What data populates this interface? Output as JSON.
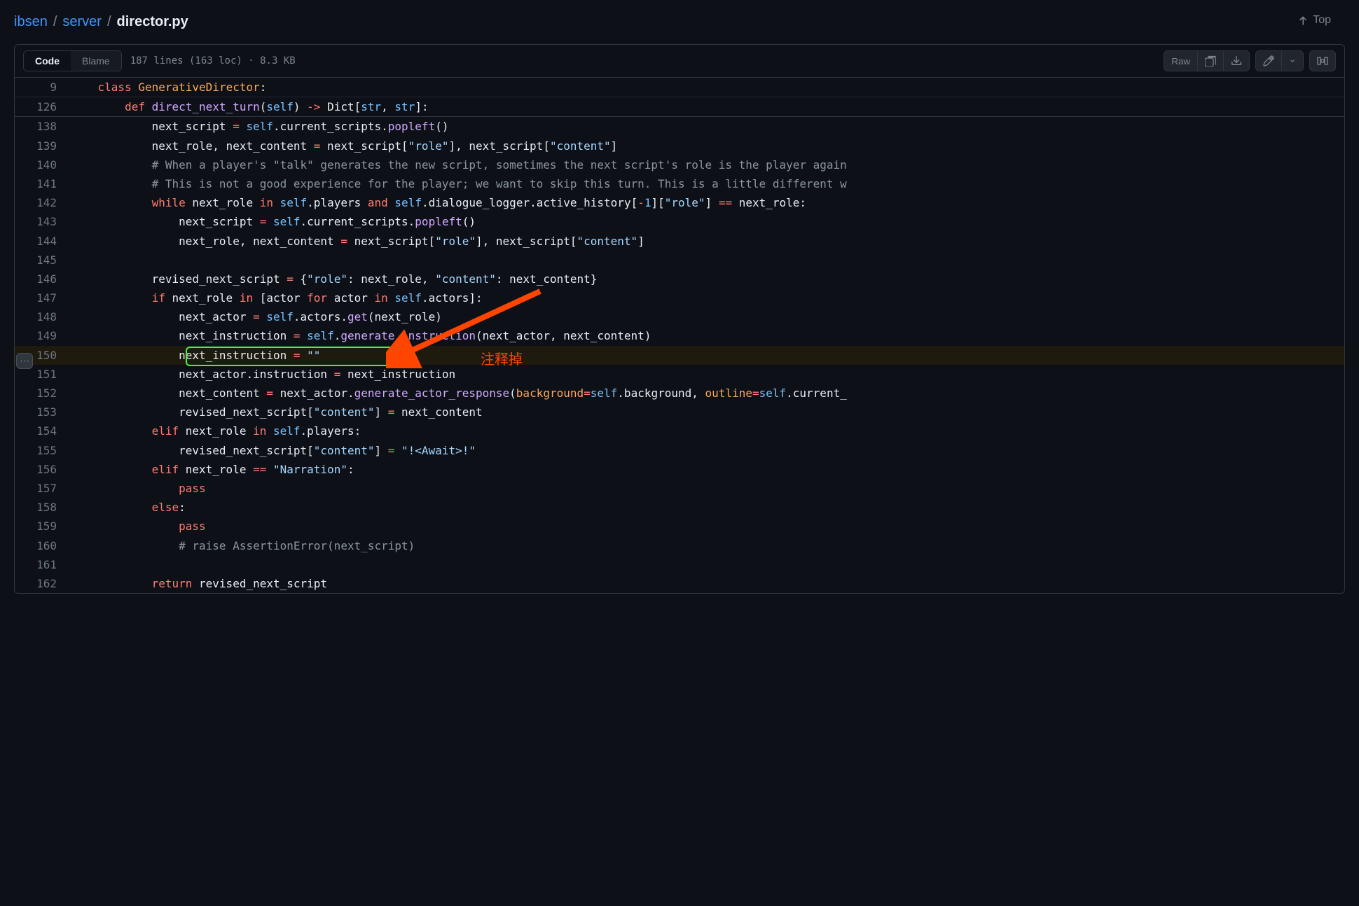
{
  "breadcrumb": {
    "parts": [
      "ibsen",
      "server"
    ],
    "current": "director.py"
  },
  "top_link": "Top",
  "toolbar": {
    "code_tab": "Code",
    "blame_tab": "Blame",
    "file_info": "187 lines (163 loc) · 8.3 KB",
    "raw": "Raw"
  },
  "annotation": "注释掉",
  "sticky": [
    {
      "num": "9",
      "tokens": [
        [
          "    ",
          ""
        ],
        [
          "class",
          "kw"
        ],
        [
          " ",
          ""
        ],
        [
          "GenerativeDirector",
          "cls"
        ],
        [
          ":",
          ""
        ]
      ]
    },
    {
      "num": "126",
      "tokens": [
        [
          "        ",
          ""
        ],
        [
          "def",
          "kw"
        ],
        [
          " ",
          ""
        ],
        [
          "direct_next_turn",
          "fn"
        ],
        [
          "(",
          ""
        ],
        [
          "self",
          "const"
        ],
        [
          ") ",
          ""
        ],
        [
          "->",
          "op"
        ],
        [
          " Dict[",
          ""
        ],
        [
          "str",
          "const"
        ],
        [
          ", ",
          ""
        ],
        [
          "str",
          "const"
        ],
        [
          "]:",
          ""
        ]
      ]
    }
  ],
  "lines": [
    {
      "num": "138",
      "tokens": [
        [
          "            next_script ",
          ""
        ],
        [
          "=",
          "op"
        ],
        [
          " ",
          ""
        ],
        [
          "self",
          "const"
        ],
        [
          ".current_scripts.",
          ""
        ],
        [
          "popleft",
          "fn"
        ],
        [
          "()",
          ""
        ]
      ]
    },
    {
      "num": "139",
      "tokens": [
        [
          "            next_role, next_content ",
          ""
        ],
        [
          "=",
          "op"
        ],
        [
          " next_script[",
          ""
        ],
        [
          "\"role\"",
          "str"
        ],
        [
          "], next_script[",
          ""
        ],
        [
          "\"content\"",
          "str"
        ],
        [
          "]",
          ""
        ]
      ]
    },
    {
      "num": "140",
      "tokens": [
        [
          "            ",
          ""
        ],
        [
          "# When a player's \"talk\" generates the new script, sometimes the next script's role is the player again",
          "cmt"
        ]
      ]
    },
    {
      "num": "141",
      "tokens": [
        [
          "            ",
          ""
        ],
        [
          "# This is not a good experience for the player; we want to skip this turn. This is a little different w",
          "cmt"
        ]
      ]
    },
    {
      "num": "142",
      "tokens": [
        [
          "            ",
          ""
        ],
        [
          "while",
          "kw"
        ],
        [
          " next_role ",
          ""
        ],
        [
          "in",
          "kw"
        ],
        [
          " ",
          ""
        ],
        [
          "self",
          "const"
        ],
        [
          ".players ",
          ""
        ],
        [
          "and",
          "kw"
        ],
        [
          " ",
          ""
        ],
        [
          "self",
          "const"
        ],
        [
          ".dialogue_logger.active_history[",
          ""
        ],
        [
          "-",
          "op"
        ],
        [
          "1",
          "num"
        ],
        [
          "][",
          ""
        ],
        [
          "\"role\"",
          "str"
        ],
        [
          "] ",
          ""
        ],
        [
          "==",
          "op"
        ],
        [
          " next_role:",
          ""
        ]
      ]
    },
    {
      "num": "143",
      "tokens": [
        [
          "                next_script ",
          ""
        ],
        [
          "=",
          "op"
        ],
        [
          " ",
          ""
        ],
        [
          "self",
          "const"
        ],
        [
          ".current_scripts.",
          ""
        ],
        [
          "popleft",
          "fn"
        ],
        [
          "()",
          ""
        ]
      ]
    },
    {
      "num": "144",
      "tokens": [
        [
          "                next_role, next_content ",
          ""
        ],
        [
          "=",
          "op"
        ],
        [
          " next_script[",
          ""
        ],
        [
          "\"role\"",
          "str"
        ],
        [
          "], next_script[",
          ""
        ],
        [
          "\"content\"",
          "str"
        ],
        [
          "]",
          ""
        ]
      ]
    },
    {
      "num": "145",
      "tokens": [
        [
          "",
          ""
        ]
      ]
    },
    {
      "num": "146",
      "tokens": [
        [
          "            revised_next_script ",
          ""
        ],
        [
          "=",
          "op"
        ],
        [
          " {",
          ""
        ],
        [
          "\"role\"",
          "str"
        ],
        [
          ": next_role, ",
          ""
        ],
        [
          "\"content\"",
          "str"
        ],
        [
          ": next_content}",
          ""
        ]
      ]
    },
    {
      "num": "147",
      "tokens": [
        [
          "            ",
          ""
        ],
        [
          "if",
          "kw"
        ],
        [
          " next_role ",
          ""
        ],
        [
          "in",
          "kw"
        ],
        [
          " [actor ",
          ""
        ],
        [
          "for",
          "kw"
        ],
        [
          " actor ",
          ""
        ],
        [
          "in",
          "kw"
        ],
        [
          " ",
          ""
        ],
        [
          "self",
          "const"
        ],
        [
          ".actors]:",
          ""
        ]
      ]
    },
    {
      "num": "148",
      "tokens": [
        [
          "                next_actor ",
          ""
        ],
        [
          "=",
          "op"
        ],
        [
          " ",
          ""
        ],
        [
          "self",
          "const"
        ],
        [
          ".actors.",
          ""
        ],
        [
          "get",
          "fn"
        ],
        [
          "(next_role)",
          ""
        ]
      ]
    },
    {
      "num": "149",
      "tokens": [
        [
          "                next_instruction ",
          ""
        ],
        [
          "=",
          "op"
        ],
        [
          " ",
          ""
        ],
        [
          "self",
          "const"
        ],
        [
          ".",
          ""
        ],
        [
          "generate_instruction",
          "fn"
        ],
        [
          "(next_actor, next_content)",
          ""
        ]
      ]
    },
    {
      "num": "150",
      "hl": true,
      "tokens": [
        [
          "                next_instruction ",
          ""
        ],
        [
          "=",
          "op"
        ],
        [
          " ",
          ""
        ],
        [
          "\"\"",
          "str"
        ]
      ]
    },
    {
      "num": "151",
      "tokens": [
        [
          "                next_actor.instruction ",
          ""
        ],
        [
          "=",
          "op"
        ],
        [
          " next_instruction",
          ""
        ]
      ]
    },
    {
      "num": "152",
      "tokens": [
        [
          "                next_content ",
          ""
        ],
        [
          "=",
          "op"
        ],
        [
          " next_actor.",
          ""
        ],
        [
          "generate_actor_response",
          "fn"
        ],
        [
          "(",
          ""
        ],
        [
          "background",
          "cls"
        ],
        [
          "=",
          "op"
        ],
        [
          "self",
          "const"
        ],
        [
          ".background, ",
          ""
        ],
        [
          "outline",
          "cls"
        ],
        [
          "=",
          "op"
        ],
        [
          "self",
          "const"
        ],
        [
          ".current_",
          ""
        ]
      ]
    },
    {
      "num": "153",
      "tokens": [
        [
          "                revised_next_script[",
          ""
        ],
        [
          "\"content\"",
          "str"
        ],
        [
          "] ",
          ""
        ],
        [
          "=",
          "op"
        ],
        [
          " next_content",
          ""
        ]
      ]
    },
    {
      "num": "154",
      "tokens": [
        [
          "            ",
          ""
        ],
        [
          "elif",
          "kw"
        ],
        [
          " next_role ",
          ""
        ],
        [
          "in",
          "kw"
        ],
        [
          " ",
          ""
        ],
        [
          "self",
          "const"
        ],
        [
          ".players:",
          ""
        ]
      ]
    },
    {
      "num": "155",
      "tokens": [
        [
          "                revised_next_script[",
          ""
        ],
        [
          "\"content\"",
          "str"
        ],
        [
          "] ",
          ""
        ],
        [
          "=",
          "op"
        ],
        [
          " ",
          ""
        ],
        [
          "\"!<Await>!\"",
          "str"
        ]
      ]
    },
    {
      "num": "156",
      "tokens": [
        [
          "            ",
          ""
        ],
        [
          "elif",
          "kw"
        ],
        [
          " next_role ",
          ""
        ],
        [
          "==",
          "op"
        ],
        [
          " ",
          ""
        ],
        [
          "\"Narration\"",
          "str"
        ],
        [
          ":",
          ""
        ]
      ]
    },
    {
      "num": "157",
      "tokens": [
        [
          "                ",
          ""
        ],
        [
          "pass",
          "kw"
        ]
      ]
    },
    {
      "num": "158",
      "tokens": [
        [
          "            ",
          ""
        ],
        [
          "else",
          "kw"
        ],
        [
          ":",
          ""
        ]
      ]
    },
    {
      "num": "159",
      "tokens": [
        [
          "                ",
          ""
        ],
        [
          "pass",
          "kw"
        ]
      ]
    },
    {
      "num": "160",
      "tokens": [
        [
          "                ",
          ""
        ],
        [
          "# raise AssertionError(next_script)",
          "cmt"
        ]
      ]
    },
    {
      "num": "161",
      "tokens": [
        [
          "",
          ""
        ]
      ]
    },
    {
      "num": "162",
      "tokens": [
        [
          "            ",
          ""
        ],
        [
          "return",
          "kw"
        ],
        [
          " revised_next_script",
          ""
        ]
      ]
    }
  ]
}
